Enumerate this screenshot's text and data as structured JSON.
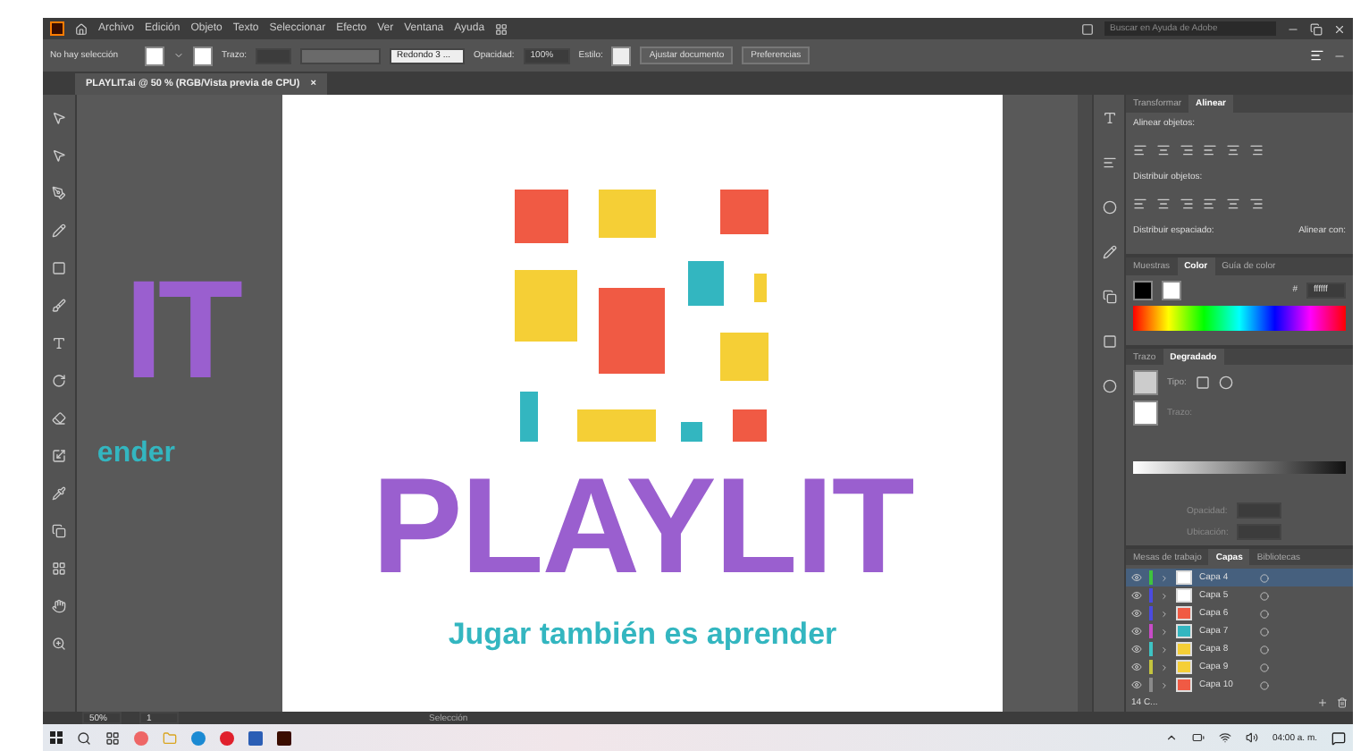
{
  "menu_bar": {
    "items": [
      "Archivo",
      "Edición",
      "Objeto",
      "Texto",
      "Seleccionar",
      "Efecto",
      "Ver",
      "Ventana",
      "Ayuda"
    ],
    "search": {
      "placeholder": "Buscar en Ayuda de Adobe"
    }
  },
  "control_bar": {
    "selection": "No hay selección",
    "stroke_label": "Trazo:",
    "brush": "Redondo 3 ...",
    "opacity_label": "Opacidad:",
    "opacity": "100%",
    "style_label": "Estilo:",
    "buttons": [
      "Ajustar documento",
      "Preferencias"
    ]
  },
  "document_tab": {
    "title": "PLAYLIT.ai @ 50 % (RGB/Vista previa de CPU)",
    "close": "×"
  },
  "canvas": {
    "offscreen_title": "IT",
    "offscreen_tagline": "ender",
    "artboard": {
      "title": "PLAYLIT",
      "tagline": "Jugar también es aprender"
    }
  },
  "align_panel": {
    "tabs": [
      {
        "label": "Transformar",
        "selected": false
      },
      {
        "label": "Alinear",
        "selected": true
      }
    ],
    "align_objects": "Alinear objetos:",
    "distribute_objects": "Distribuir objetos:",
    "distribute_spacing": "Distribuir espaciado:",
    "align_to": "Alinear con:"
  },
  "color_panel": {
    "tabs": [
      {
        "label": "Muestras",
        "selected": false
      },
      {
        "label": "Color",
        "selected": true
      },
      {
        "label": "Guía de color",
        "selected": false
      }
    ],
    "hash": "#",
    "hex": "ffffff"
  },
  "gradient_panel": {
    "tabs": [
      {
        "label": "Trazo",
        "selected": false
      },
      {
        "label": "Degradado",
        "selected": true
      }
    ],
    "type_label": "Tipo:",
    "stroke_label": "Trazo:",
    "opacity_label": "Opacidad:",
    "location_label": "Ubicación:"
  },
  "layers_panel": {
    "tabs": [
      {
        "label": "Mesas de trabajo",
        "selected": false
      },
      {
        "label": "Capas",
        "selected": true
      },
      {
        "label": "Bibliotecas",
        "selected": false
      }
    ],
    "layers": [
      {
        "name": "Capa 4",
        "color": "#3ec43e",
        "thumb": {
          "color": "#ffffff"
        },
        "selected": true
      },
      {
        "name": "Capa 5",
        "color": "#4b4be0",
        "thumb": {
          "color": "#ffffff"
        },
        "selected": false
      },
      {
        "name": "Capa 6",
        "color": "#4b4be0",
        "thumb": {
          "color": "#f05a44"
        },
        "selected": false
      },
      {
        "name": "Capa 7",
        "color": "#c84bc8",
        "thumb": {
          "color": "#33b6c0"
        },
        "selected": false
      },
      {
        "name": "Capa 8",
        "color": "#3ec4c4",
        "thumb": {
          "color": "#f5cf36"
        },
        "selected": false
      },
      {
        "name": "Capa 9",
        "color": "#c4c43e",
        "thumb": {
          "color": "#f5cf36"
        },
        "selected": false
      },
      {
        "name": "Capa 10",
        "color": "#8a8a8a",
        "thumb": {
          "color": "#f05a44"
        },
        "selected": false
      }
    ],
    "count": "14 C..."
  },
  "status_bar": {
    "zoom": "50%",
    "page": "1",
    "tool": "Selección"
  },
  "taskbar": {
    "time": "04:00 a. m."
  }
}
